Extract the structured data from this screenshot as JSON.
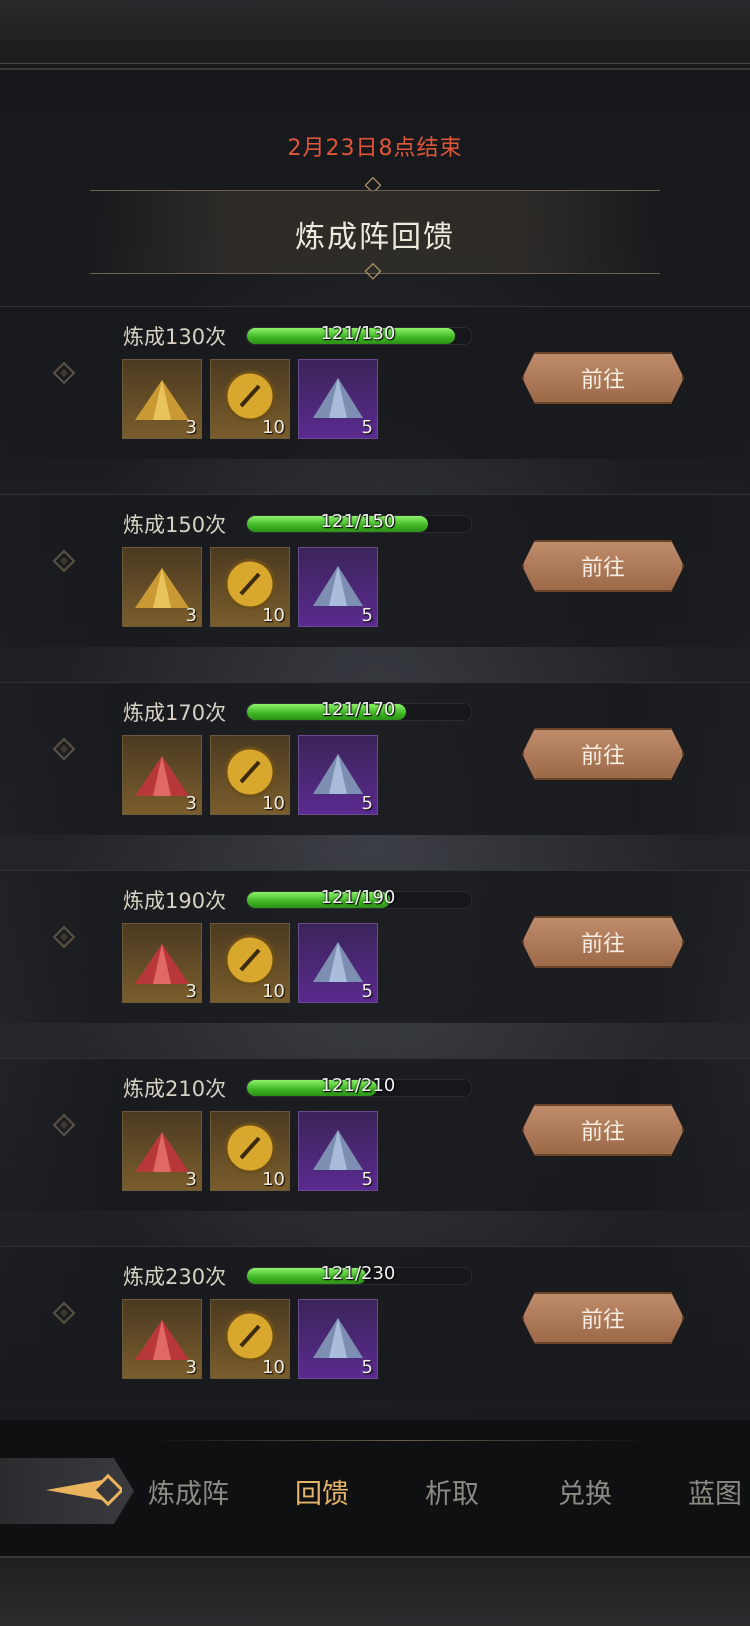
{
  "header": {
    "event_time": "2月23日8点结束",
    "title": "炼成阵回馈"
  },
  "tasks": [
    {
      "label": "炼成130次",
      "progress_text": "121/130",
      "progress": 0.93,
      "items": [
        {
          "icon": "gold-crystal-icon",
          "qty": "3"
        },
        {
          "icon": "gold-eye-medal-icon",
          "qty": "10"
        },
        {
          "icon": "blue-crystal-icon",
          "qty": "5"
        }
      ],
      "button": "前往"
    },
    {
      "label": "炼成150次",
      "progress_text": "121/150",
      "progress": 0.81,
      "items": [
        {
          "icon": "gold-crystal-icon",
          "qty": "3"
        },
        {
          "icon": "gold-eye-medal-icon",
          "qty": "10"
        },
        {
          "icon": "blue-crystal-icon",
          "qty": "5"
        }
      ],
      "button": "前往"
    },
    {
      "label": "炼成170次",
      "progress_text": "121/170",
      "progress": 0.71,
      "items": [
        {
          "icon": "red-crystal-icon",
          "qty": "3"
        },
        {
          "icon": "gold-eye-medal-icon",
          "qty": "10"
        },
        {
          "icon": "blue-crystal-icon",
          "qty": "5"
        }
      ],
      "button": "前往"
    },
    {
      "label": "炼成190次",
      "progress_text": "121/190",
      "progress": 0.64,
      "items": [
        {
          "icon": "red-crystal-icon",
          "qty": "3"
        },
        {
          "icon": "gold-eye-medal-icon",
          "qty": "10"
        },
        {
          "icon": "blue-crystal-icon",
          "qty": "5"
        }
      ],
      "button": "前往"
    },
    {
      "label": "炼成210次",
      "progress_text": "121/210",
      "progress": 0.58,
      "items": [
        {
          "icon": "red-crystal-icon",
          "qty": "3"
        },
        {
          "icon": "gold-eye-medal-icon",
          "qty": "10"
        },
        {
          "icon": "blue-crystal-icon",
          "qty": "5"
        }
      ],
      "button": "前往"
    },
    {
      "label": "炼成230次",
      "progress_text": "121/230",
      "progress": 0.53,
      "items": [
        {
          "icon": "red-crystal-icon",
          "qty": "3"
        },
        {
          "icon": "gold-eye-medal-icon",
          "qty": "10"
        },
        {
          "icon": "blue-crystal-icon",
          "qty": "5"
        }
      ],
      "button": "前往"
    }
  ],
  "tabs": [
    {
      "label": "炼成阵",
      "active": false
    },
    {
      "label": "回馈",
      "active": true
    },
    {
      "label": "析取",
      "active": false
    },
    {
      "label": "兑换",
      "active": false
    },
    {
      "label": "蓝图",
      "active": false
    }
  ],
  "colors": {
    "event_time": "#e0563a",
    "progress_fill": "#4fcf2f",
    "go_button": "#b07a58",
    "active_tab": "#e7b56a"
  }
}
